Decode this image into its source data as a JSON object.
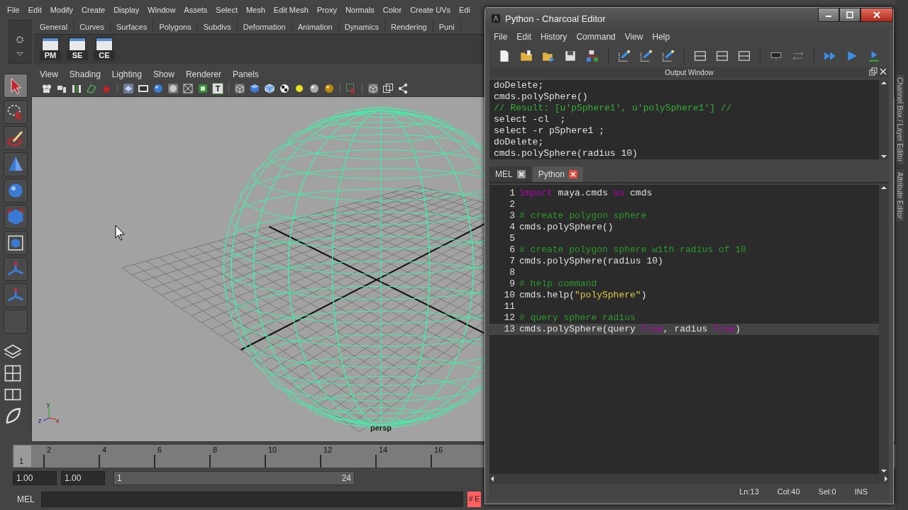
{
  "main_menu": [
    "File",
    "Edit",
    "Modify",
    "Create",
    "Display",
    "Window",
    "Assets",
    "Select",
    "Mesh",
    "Edit Mesh",
    "Proxy",
    "Normals",
    "Color",
    "Create UVs",
    "Edi"
  ],
  "shelf": {
    "tabs": [
      "General",
      "Curves",
      "Surfaces",
      "Polygons",
      "Subdivs",
      "Deformation",
      "Animation",
      "Dynamics",
      "Rendering",
      "Puni"
    ],
    "buttons": [
      "PM",
      "SE",
      "CE"
    ]
  },
  "toolbox": [
    {
      "selected": true
    },
    {
      "selected": false
    },
    {
      "selected": false
    },
    {
      "selected": false
    },
    {
      "selected": false
    },
    {
      "selected": false
    },
    {
      "selected": false
    },
    {
      "selected": false
    },
    {
      "selected": false
    },
    {
      "selected": false
    }
  ],
  "viewport": {
    "menu": [
      "View",
      "Shading",
      "Lighting",
      "Show",
      "Renderer",
      "Panels"
    ],
    "toolbar_text_icon": "T",
    "camera_label": "persp",
    "axis_labels": [
      "y",
      "z",
      "x"
    ]
  },
  "timeline": {
    "current_frame": "1",
    "ticks": [
      "2",
      "4",
      "6",
      "8",
      "10",
      "12",
      "14",
      "16"
    ]
  },
  "range": {
    "start_time": "1.00",
    "playback_start": "1.00",
    "range_start": "1",
    "range_end": "24"
  },
  "command_line": {
    "language": "MEL",
    "error": "# E"
  },
  "side_tabs": [
    "Channel Box / Layer Editor",
    "Attribute Editor"
  ],
  "editor": {
    "title": "Python - Charcoal Editor",
    "menu": [
      "File",
      "Edit",
      "History",
      "Command",
      "View",
      "Help"
    ],
    "output_title": "Output Window",
    "output_lines": [
      {
        "text": "doDelete;",
        "kind": "echo"
      },
      {
        "text": "cmds.polySphere()",
        "kind": "echo"
      },
      {
        "text": "// Result: [u'pSphere1', u'polySphere1'] //",
        "kind": "result"
      },
      {
        "text": "select -cl  ;",
        "kind": "echo"
      },
      {
        "text": "select -r pSphere1 ;",
        "kind": "echo"
      },
      {
        "text": "doDelete;",
        "kind": "echo"
      },
      {
        "text": "cmds.polySphere(radius 10)",
        "kind": "echo"
      }
    ],
    "tabs": [
      {
        "label": "MEL",
        "selected": false
      },
      {
        "label": "Python",
        "selected": true
      }
    ],
    "code": [
      {
        "number": "1",
        "current": false,
        "tokens": [
          {
            "text": "import",
            "kind": "keyword"
          },
          {
            "text": " maya.cmds ",
            "kind": "plain"
          },
          {
            "text": "as",
            "kind": "keyword"
          },
          {
            "text": " cmds",
            "kind": "plain"
          }
        ]
      },
      {
        "number": "2",
        "current": false
      },
      {
        "number": "3",
        "current": false,
        "tokens": [
          {
            "text": "# create polygon sphere",
            "kind": "comment"
          }
        ]
      },
      {
        "number": "4",
        "current": false,
        "tokens": [
          {
            "text": "cmds.polySphere()",
            "kind": "plain"
          }
        ]
      },
      {
        "number": "5",
        "current": false
      },
      {
        "number": "6",
        "current": false,
        "tokens": [
          {
            "text": "# create polygon sphere with radius of 10",
            "kind": "comment"
          }
        ]
      },
      {
        "number": "7",
        "current": false,
        "tokens": [
          {
            "text": "cmds.polySphere(radius 10)",
            "kind": "plain"
          }
        ]
      },
      {
        "number": "8",
        "current": false
      },
      {
        "number": "9",
        "current": false,
        "tokens": [
          {
            "text": "# help command",
            "kind": "comment"
          }
        ]
      },
      {
        "number": "10",
        "current": false,
        "tokens": [
          {
            "text": "cmds.help(",
            "kind": "plain"
          },
          {
            "text": "\"polySphere\"",
            "kind": "string"
          },
          {
            "text": ")",
            "kind": "plain"
          }
        ]
      },
      {
        "number": "11",
        "current": false
      },
      {
        "number": "12",
        "current": false,
        "tokens": [
          {
            "text": "# query sphere radius",
            "kind": "comment"
          }
        ]
      },
      {
        "number": "13",
        "current": true,
        "tokens": [
          {
            "text": "cmds.polySphere(query ",
            "kind": "plain"
          },
          {
            "text": "True",
            "kind": "keyword"
          },
          {
            "text": ", radius ",
            "kind": "plain"
          },
          {
            "text": "True",
            "kind": "keyword"
          },
          {
            "text": ")",
            "kind": "plain"
          }
        ]
      }
    ],
    "status": [
      "Ln:13",
      "Col:40",
      "Sel:0",
      "INS"
    ]
  }
}
